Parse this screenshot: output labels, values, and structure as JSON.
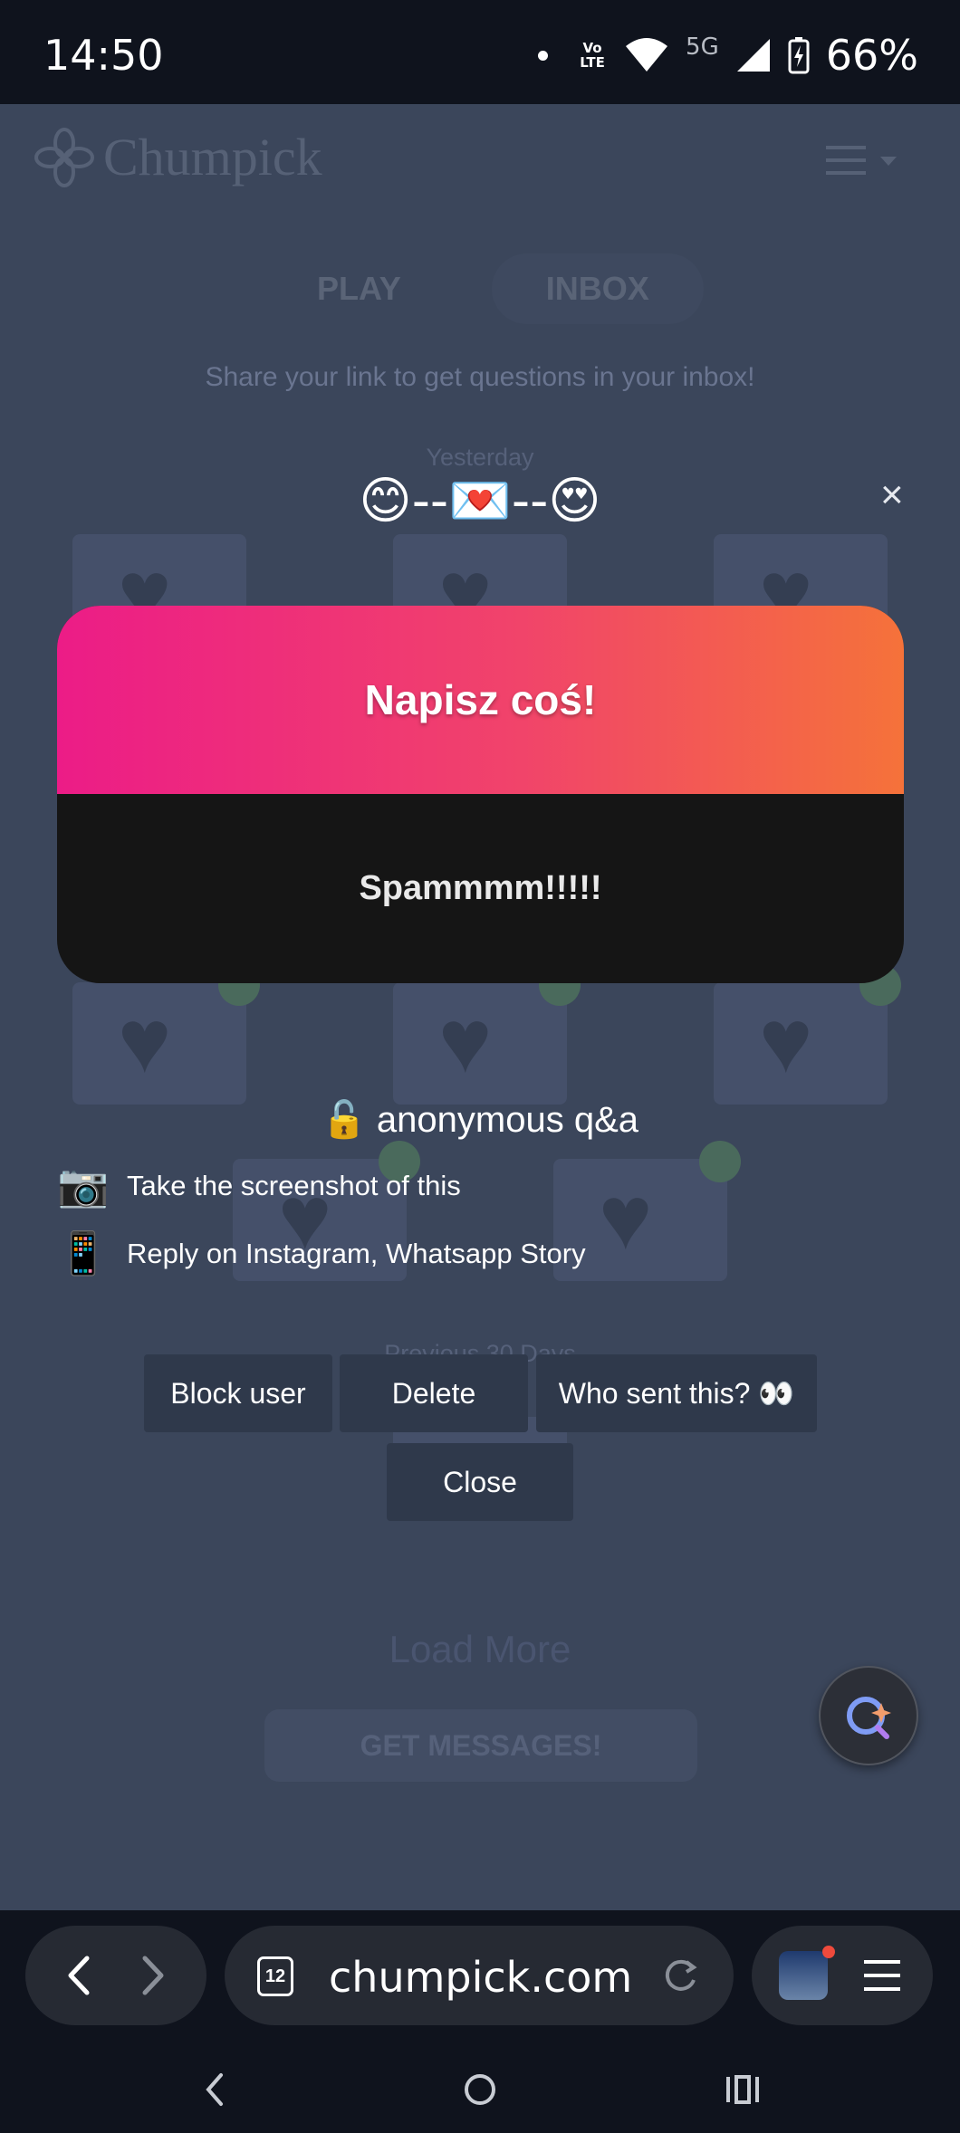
{
  "status_bar": {
    "time": "14:50",
    "network": "5G",
    "volte": "Vo LTE",
    "battery": "66%"
  },
  "page": {
    "brand": "Chumpick",
    "tabs": [
      "PLAY",
      "INBOX"
    ],
    "share_text": "Share your link to get questions in your inbox!",
    "yesterday_label": "Yesterday",
    "previous_label": "Previous 30 Days",
    "load_more": "Load More",
    "get_messages": "GET MESSAGES!"
  },
  "modal": {
    "emoji_header": "😊--💌--😍",
    "close_symbol": "×",
    "title": "Napisz coś!",
    "message": "Spammmm!!!!!",
    "anon_title": "🔓 anonymous q&a",
    "instructions": [
      {
        "icon": "📷",
        "text": "Take the screenshot of this"
      },
      {
        "icon": "📱",
        "text": "Reply on Instagram, Whatsapp Story"
      }
    ],
    "buttons": {
      "block": "Block user",
      "delete": "Delete",
      "who": "Who sent this? 👀",
      "close": "Close"
    }
  },
  "browser": {
    "url": "chumpick.com",
    "tab_count": "12"
  }
}
